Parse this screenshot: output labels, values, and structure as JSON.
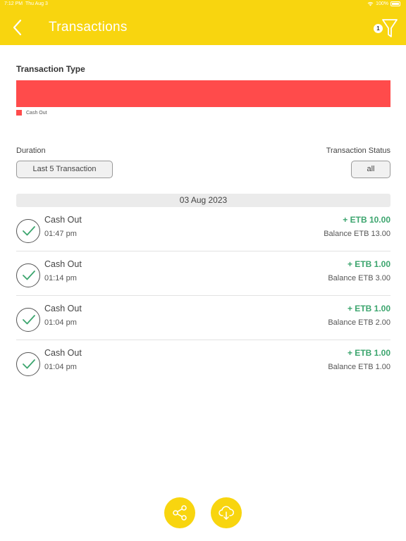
{
  "status_bar": {
    "time": "7:12 PM",
    "date": "Thu Aug 3",
    "battery": "100%"
  },
  "header": {
    "title": "Transactions",
    "filter_count": "1"
  },
  "transaction_type": {
    "title": "Transaction Type",
    "legend": [
      {
        "label": "Cash Out",
        "color": "#ff4b4b"
      }
    ]
  },
  "filters": {
    "duration_label": "Duration",
    "duration_value": "Last 5 Transaction",
    "status_label": "Transaction Status",
    "status_value": "all"
  },
  "date_group": "03 Aug 2023",
  "transactions": [
    {
      "title": "Cash Out",
      "time": "01:47 pm",
      "amount": "+ ETB 10.00",
      "balance": "Balance ETB 13.00"
    },
    {
      "title": "Cash Out",
      "time": "01:14 pm",
      "amount": "+ ETB 1.00",
      "balance": "Balance ETB 3.00"
    },
    {
      "title": "Cash Out",
      "time": "01:04 pm",
      "amount": "+ ETB 1.00",
      "balance": "Balance ETB 2.00"
    },
    {
      "title": "Cash Out",
      "time": "01:04 pm",
      "amount": "+ ETB 1.00",
      "balance": "Balance ETB 1.00"
    }
  ],
  "colors": {
    "accent": "#f8d50f",
    "amount_positive": "#3ca56e",
    "cash_out": "#ff4b4b",
    "check": "#3ca56e"
  },
  "icons": {
    "back": "chevron-left-icon",
    "filter": "funnel-icon",
    "status": "check-circle-icon",
    "share": "share-icon",
    "download": "cloud-download-icon"
  }
}
